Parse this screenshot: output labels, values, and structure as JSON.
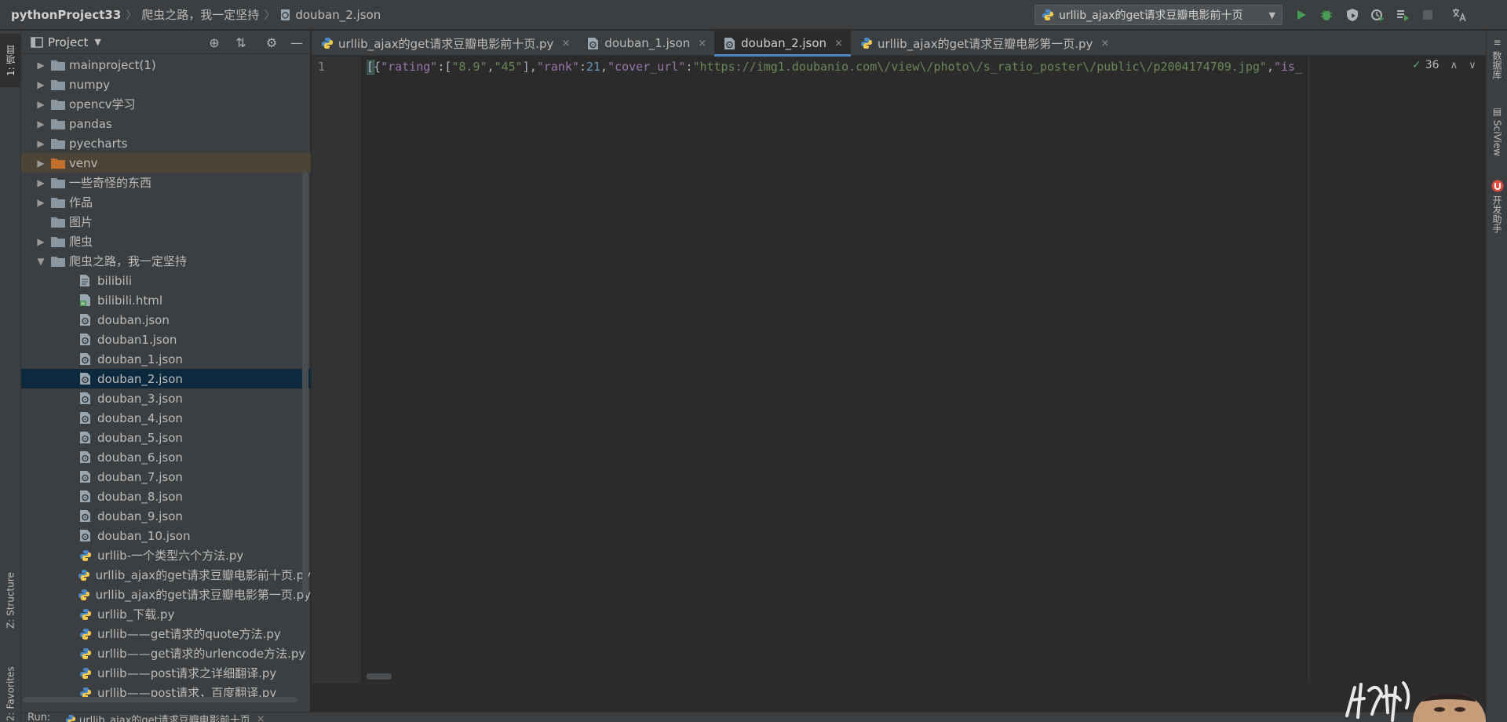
{
  "navbar": {
    "breadcrumbs": [
      "pythonProject33",
      "爬虫之路，我一定坚持",
      "douban_2.json"
    ],
    "run_config": "urllib_ajax的get请求豆瓣电影前十页"
  },
  "left_stripe": {
    "project_tab": "1: 项目",
    "structure_tab": "Z: Structure",
    "favorites_tab": "2: Favorites"
  },
  "right_stripe": {
    "database_tab": "数据库",
    "sciview_tab": "SciView",
    "assistant_tab": "开发助手"
  },
  "project_panel": {
    "title": "Project",
    "tree": [
      {
        "label": "mainproject(1)",
        "kind": "folder",
        "level": 1,
        "expanded": false
      },
      {
        "label": "numpy",
        "kind": "folder",
        "level": 1,
        "expanded": false
      },
      {
        "label": "opencv学习",
        "kind": "folder",
        "level": 1,
        "expanded": false
      },
      {
        "label": "pandas",
        "kind": "folder",
        "level": 1,
        "expanded": false
      },
      {
        "label": "pyecharts",
        "kind": "folder",
        "level": 1,
        "expanded": false
      },
      {
        "label": "venv",
        "kind": "folder-excluded",
        "level": 1,
        "expanded": false
      },
      {
        "label": "一些奇怪的东西",
        "kind": "folder",
        "level": 1,
        "expanded": false
      },
      {
        "label": "作品",
        "kind": "folder",
        "level": 1,
        "expanded": false
      },
      {
        "label": "图片",
        "kind": "folder",
        "level": 1,
        "expanded": null
      },
      {
        "label": "爬虫",
        "kind": "folder",
        "level": 1,
        "expanded": false
      },
      {
        "label": "爬虫之路，我一定坚持",
        "kind": "folder",
        "level": 1,
        "expanded": true
      },
      {
        "label": "bilibili",
        "kind": "text",
        "level": 2
      },
      {
        "label": "bilibili.html",
        "kind": "html",
        "level": 2
      },
      {
        "label": "douban.json",
        "kind": "json",
        "level": 2
      },
      {
        "label": "douban1.json",
        "kind": "json",
        "level": 2
      },
      {
        "label": "douban_1.json",
        "kind": "json",
        "level": 2
      },
      {
        "label": "douban_2.json",
        "kind": "json",
        "level": 2
      },
      {
        "label": "douban_3.json",
        "kind": "json",
        "level": 2
      },
      {
        "label": "douban_4.json",
        "kind": "json",
        "level": 2
      },
      {
        "label": "douban_5.json",
        "kind": "json",
        "level": 2
      },
      {
        "label": "douban_6.json",
        "kind": "json",
        "level": 2
      },
      {
        "label": "douban_7.json",
        "kind": "json",
        "level": 2
      },
      {
        "label": "douban_8.json",
        "kind": "json",
        "level": 2
      },
      {
        "label": "douban_9.json",
        "kind": "json",
        "level": 2
      },
      {
        "label": "douban_10.json",
        "kind": "json",
        "level": 2
      },
      {
        "label": "urllib-一个类型六个方法.py",
        "kind": "python",
        "level": 2
      },
      {
        "label": "urllib_ajax的get请求豆瓣电影前十页.py",
        "kind": "python",
        "level": 2
      },
      {
        "label": "urllib_ajax的get请求豆瓣电影第一页.py",
        "kind": "python",
        "level": 2
      },
      {
        "label": "urllib_下载.py",
        "kind": "python",
        "level": 2
      },
      {
        "label": "urllib——get请求的quote方法.py",
        "kind": "python",
        "level": 2
      },
      {
        "label": "urllib——get请求的urlencode方法.py",
        "kind": "python",
        "level": 2
      },
      {
        "label": "urllib——post请求之详细翻译.py",
        "kind": "python",
        "level": 2
      },
      {
        "label": "urllib——post请求，百度翻译.py",
        "kind": "python",
        "level": 2
      }
    ],
    "selected": "douban_2.json",
    "highlighted": "venv"
  },
  "editor_tabs": [
    {
      "label": "urllib_ajax的get请求豆瓣电影前十页.py",
      "kind": "python",
      "active": false
    },
    {
      "label": "douban_1.json",
      "kind": "json",
      "active": false
    },
    {
      "label": "douban_2.json",
      "kind": "json",
      "active": true
    },
    {
      "label": "urllib_ajax的get请求豆瓣电影第一页.py",
      "kind": "python",
      "active": false
    }
  ],
  "editor": {
    "line_number": "1",
    "inspection_count": "36",
    "code_tokens": [
      {
        "t": "[",
        "c": "bracket"
      },
      {
        "t": "{",
        "c": "punct"
      },
      {
        "t": "\"rating\"",
        "c": "key"
      },
      {
        "t": ":[",
        "c": "punct"
      },
      {
        "t": "\"8.9\"",
        "c": "str"
      },
      {
        "t": ",",
        "c": "punct"
      },
      {
        "t": "\"45\"",
        "c": "str"
      },
      {
        "t": "],",
        "c": "punct"
      },
      {
        "t": "\"rank\"",
        "c": "key"
      },
      {
        "t": ":",
        "c": "punct"
      },
      {
        "t": "21",
        "c": "num"
      },
      {
        "t": ",",
        "c": "punct"
      },
      {
        "t": "\"cover_url\"",
        "c": "key"
      },
      {
        "t": ":",
        "c": "punct"
      },
      {
        "t": "\"https://img1.doubanio.com\\/view\\/photo\\/s_ratio_poster\\/public\\/p2004174709.jpg\"",
        "c": "str"
      },
      {
        "t": ",",
        "c": "punct"
      },
      {
        "t": "\"is_",
        "c": "key"
      }
    ]
  },
  "run_bar": {
    "label": "Run:",
    "tab": "urllib_ajax的get请求豆瓣电影前十页"
  },
  "colors": {
    "background": "#2b2b2b",
    "panel": "#3c3f41",
    "selection": "#0d293e",
    "accent": "#4a88c7",
    "json_key": "#9876aa",
    "json_string": "#6a8759",
    "json_number": "#6897bb"
  }
}
